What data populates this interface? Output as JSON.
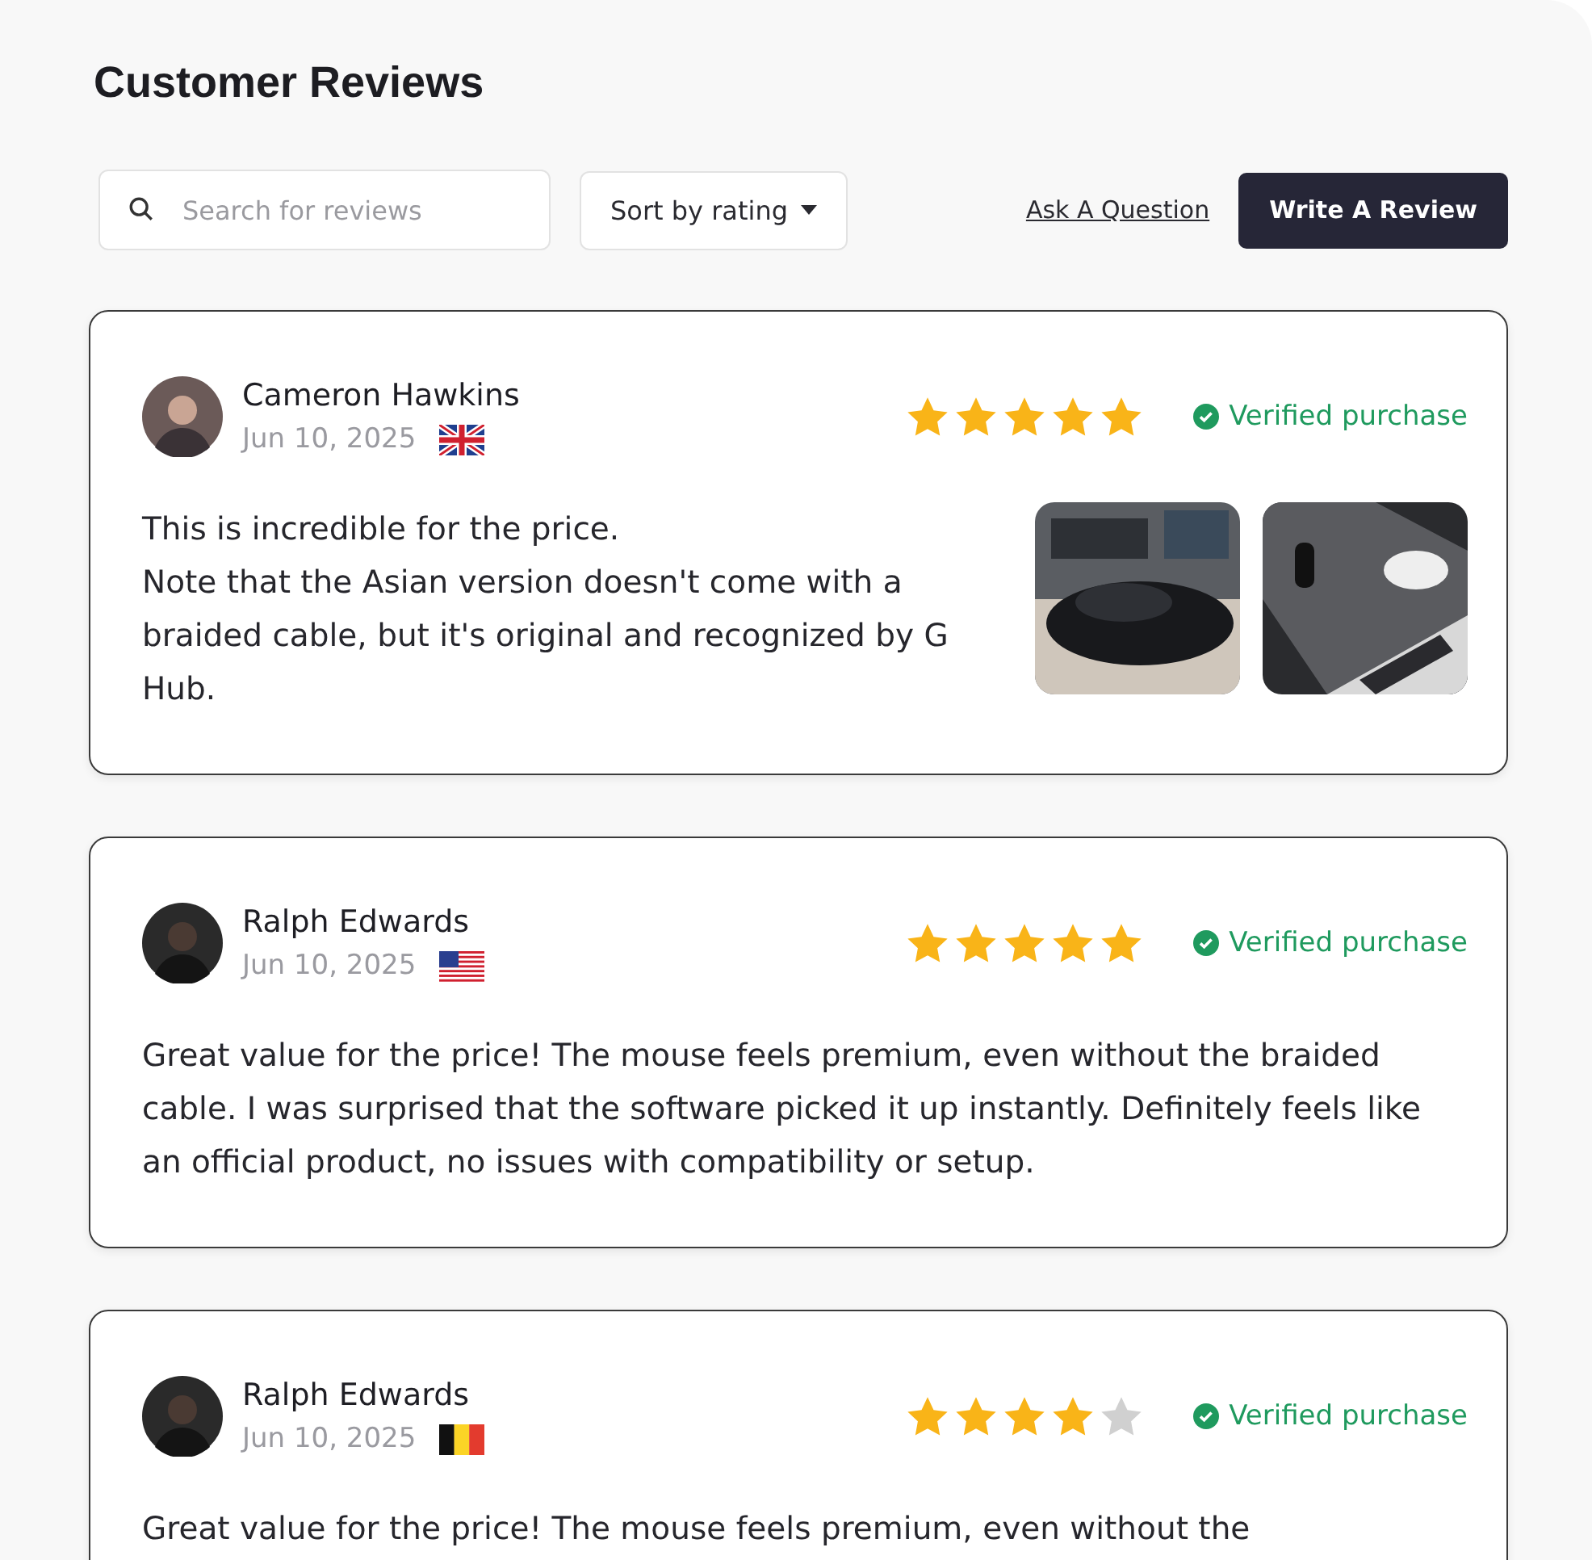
{
  "title": "Customer Reviews",
  "toolbar": {
    "search": {
      "placeholder": "Search for reviews"
    },
    "sort": {
      "label": "Sort by rating"
    },
    "question_link": "Ask A Question",
    "write_button": "Write A Review"
  },
  "reviews": [
    {
      "name": "Cameron Hawkins",
      "date": "Jun 10, 2025",
      "flag": {
        "kind": "uk"
      },
      "stars": 5,
      "verified": true,
      "verified_label": "Verified purchase",
      "text": "This is incredible for the price.\nNote that the Asian version doesn't come with a braided cable, but it's original and recognized by G Hub.",
      "photos": [
        {
          "kind": "picture"
        },
        {
          "kind": "picture"
        }
      ]
    },
    {
      "name": "Ralph Edwards",
      "date": "Jun 10, 2025",
      "flag": {
        "kind": "us"
      },
      "stars": 5,
      "verified": true,
      "verified_label": "Verified purchase",
      "text": "Great value for the price! The mouse feels premium, even without the braided cable. I was surprised that the software picked it up instantly. Definitely feels like an official product, no issues with compatibility or setup."
    },
    {
      "name": "Ralph Edwards",
      "date": "Jun 10, 2025",
      "flag": {
        "kind": "be"
      },
      "stars": 4,
      "verified": true,
      "verified_label": "Verified purchase",
      "text": "Great value for the price! The mouse feels premium, even without the"
    }
  ]
}
